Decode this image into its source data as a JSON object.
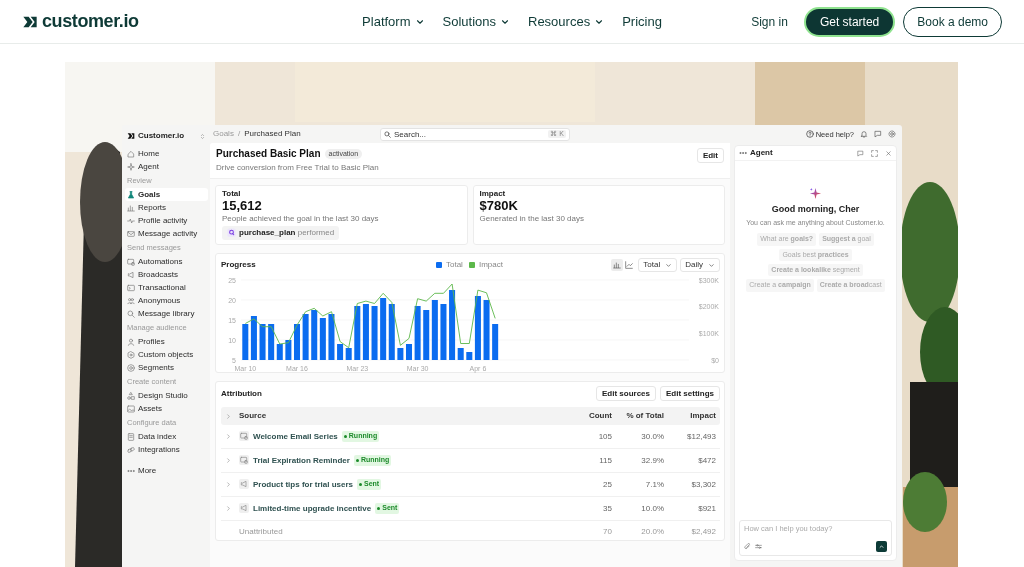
{
  "nav": {
    "logo": "customer.io",
    "items": [
      {
        "label": "Platform",
        "dropdown": true
      },
      {
        "label": "Solutions",
        "dropdown": true
      },
      {
        "label": "Resources",
        "dropdown": true
      },
      {
        "label": "Pricing",
        "dropdown": false
      }
    ],
    "sign_in": "Sign in",
    "cta": "Get started",
    "demo": "Book a demo"
  },
  "app": {
    "workspace": "Customer.io",
    "sidebar": [
      {
        "kind": "item",
        "label": "Home",
        "selected": false
      },
      {
        "kind": "item",
        "label": "Agent",
        "selected": false
      },
      {
        "kind": "heading",
        "label": "Review"
      },
      {
        "kind": "item",
        "label": "Goals",
        "selected": true
      },
      {
        "kind": "item",
        "label": "Reports",
        "selected": false
      },
      {
        "kind": "item",
        "label": "Profile activity",
        "selected": false
      },
      {
        "kind": "item",
        "label": "Message activity",
        "selected": false
      },
      {
        "kind": "heading",
        "label": "Send messages"
      },
      {
        "kind": "item",
        "label": "Automations",
        "selected": false
      },
      {
        "kind": "item",
        "label": "Broadcasts",
        "selected": false
      },
      {
        "kind": "item",
        "label": "Transactional",
        "selected": false
      },
      {
        "kind": "item",
        "label": "Anonymous",
        "selected": false
      },
      {
        "kind": "item",
        "label": "Message library",
        "selected": false
      },
      {
        "kind": "heading",
        "label": "Manage audience"
      },
      {
        "kind": "item",
        "label": "Profiles",
        "selected": false
      },
      {
        "kind": "item",
        "label": "Custom objects",
        "selected": false
      },
      {
        "kind": "item",
        "label": "Segments",
        "selected": false
      },
      {
        "kind": "heading",
        "label": "Create content"
      },
      {
        "kind": "item",
        "label": "Design Studio",
        "selected": false
      },
      {
        "kind": "item",
        "label": "Assets",
        "selected": false
      },
      {
        "kind": "heading",
        "label": "Configure data"
      },
      {
        "kind": "item",
        "label": "Data index",
        "selected": false
      },
      {
        "kind": "item",
        "label": "Integrations",
        "selected": false
      },
      {
        "kind": "more",
        "label": "More",
        "selected": false
      }
    ],
    "breadcrumb": {
      "items": [
        "Goals",
        "Purchased Plan"
      ],
      "separator": "/"
    },
    "search": {
      "placeholder": "Search...",
      "shortcut": "⌘ K"
    },
    "help": "Need help?",
    "goal": {
      "title": "Purchased Basic Plan",
      "tag": "activation",
      "description": "Drive conversion from Free Trial to Basic Plan",
      "edit": "Edit"
    },
    "stats": [
      {
        "label": "Total",
        "value": "15,612",
        "caption": "People achieved the goal in the last 30 days",
        "event": "purchase_plan",
        "event_suffix": "performed"
      },
      {
        "label": "Impact",
        "value": "$780K",
        "caption": "Generated in the last 30 days"
      }
    ],
    "progress": {
      "title": "Progress",
      "view_toggle": [
        {
          "selected": true
        },
        {
          "selected": false
        }
      ],
      "metric": "Total",
      "interval": "Daily",
      "chart_data": {
        "type": "bar",
        "categories": [
          "Mar 10",
          null,
          null,
          null,
          null,
          null,
          "Mar 16",
          null,
          null,
          null,
          null,
          null,
          null,
          "Mar 23",
          null,
          null,
          null,
          null,
          null,
          null,
          "Mar 30",
          null,
          null,
          null,
          null,
          null,
          null,
          "Apr 6",
          null,
          null,
          null,
          null,
          null,
          null,
          null,
          null,
          null,
          null,
          null,
          null,
          null,
          null,
          null,
          null,
          null,
          null,
          null,
          null,
          null,
          null,
          null,
          null
        ],
        "series": [
          {
            "name": "Total",
            "color": "#0b6cf0",
            "values": [
              14,
              16,
              14,
              14,
              9,
              10,
              14,
              16.5,
              17.5,
              15.5,
              16.5,
              9,
              8,
              18.5,
              19,
              18.5,
              20.5,
              19,
              8,
              9,
              18.5,
              17.5,
              20,
              19,
              22.5,
              8,
              7,
              21,
              20,
              14,
              null,
              null,
              null,
              null,
              null,
              null,
              null,
              null,
              null,
              null,
              null,
              null,
              null,
              null,
              null,
              null,
              null,
              null,
              null,
              null,
              null,
              null
            ]
          }
        ],
        "ylim": [
          5,
          25
        ],
        "yticks": [
          {
            "value": 5,
            "label": "5"
          },
          {
            "value": 10,
            "label": "10"
          },
          {
            "value": 15,
            "label": "15"
          },
          {
            "value": 20,
            "label": "20"
          },
          {
            "value": 25,
            "label": "25"
          }
        ]
      },
      "impact_overlay": {
        "chart_data": {
          "type": "line",
          "categories": [
            null,
            null,
            null,
            null,
            null,
            null,
            null,
            null,
            null,
            null,
            null,
            null,
            null,
            null,
            null,
            null,
            null,
            null,
            null,
            null,
            null,
            null,
            null,
            null,
            null,
            null,
            null,
            null,
            null,
            null,
            null,
            null,
            null,
            null,
            null,
            null,
            null,
            null,
            null,
            null,
            null,
            null,
            null,
            null,
            null,
            null,
            null,
            null,
            null,
            null,
            null,
            null
          ],
          "series": [
            {
              "name": "Impact",
              "color": "#5cb84a",
              "values": [
                137,
                154,
                125,
                125,
                60,
                65,
                131,
                181,
                194,
                165,
                181,
                69,
                46,
                212,
                221,
                212,
                250,
                216,
                55,
                81,
                230,
                221,
                250,
                250,
                285,
                62,
                62,
                262,
                252,
                156,
                null,
                null,
                null,
                null,
                null,
                null,
                null,
                null,
                null,
                null,
                null,
                null,
                null,
                null,
                null,
                null,
                null,
                null,
                null,
                null,
                null,
                null
              ]
            }
          ],
          "ylim": [
            0,
            300
          ],
          "yticks": [
            {
              "value": 0,
              "label": "$0"
            },
            {
              "value": 100,
              "label": "$100K"
            },
            {
              "value": 200,
              "label": "$200K"
            },
            {
              "value": 300,
              "label": "$300K"
            }
          ]
        }
      }
    },
    "attribution": {
      "title": "Attribution",
      "buttons": [
        "Edit sources",
        "Edit settings"
      ],
      "columns": [
        "Source",
        "Count",
        "% of Total",
        "Impact"
      ],
      "rows": [
        {
          "kind": "campaign",
          "expanded": false,
          "name": "Welcome Email Series",
          "status": "Running",
          "count": "105",
          "share": "30.0%",
          "impact": "$12,493"
        },
        {
          "kind": "campaign",
          "expanded": false,
          "name": "Trial Expiration Reminder",
          "status": "Running",
          "count": "115",
          "share": "32.9%",
          "impact": "$472"
        },
        {
          "kind": "broadcast",
          "expanded": false,
          "name": "Product tips for trial users",
          "status": "Sent",
          "count": "25",
          "share": "7.1%",
          "impact": "$3,302"
        },
        {
          "kind": "broadcast",
          "expanded": false,
          "name": "Limited-time upgrade incentive",
          "status": "Sent",
          "count": "35",
          "share": "10.0%",
          "impact": "$921"
        }
      ],
      "unattributed": {
        "name": "Unattributed",
        "count": "70",
        "share": "20.0%",
        "impact": "$2,492"
      }
    },
    "agent": {
      "title": "Agent",
      "greeting": "Good morning, Cher",
      "subtitle": "You can ask me anything about Customer.io.",
      "suggestions": [
        [
          "What are **goals?**",
          "**Suggest a** goal"
        ],
        [
          "Goals best **practices**",
          "**Create a lookalike** segment"
        ],
        [
          "Create a **campaign**",
          "**Create a broad**cast"
        ]
      ],
      "input_placeholder": "How can I help you today?"
    }
  }
}
